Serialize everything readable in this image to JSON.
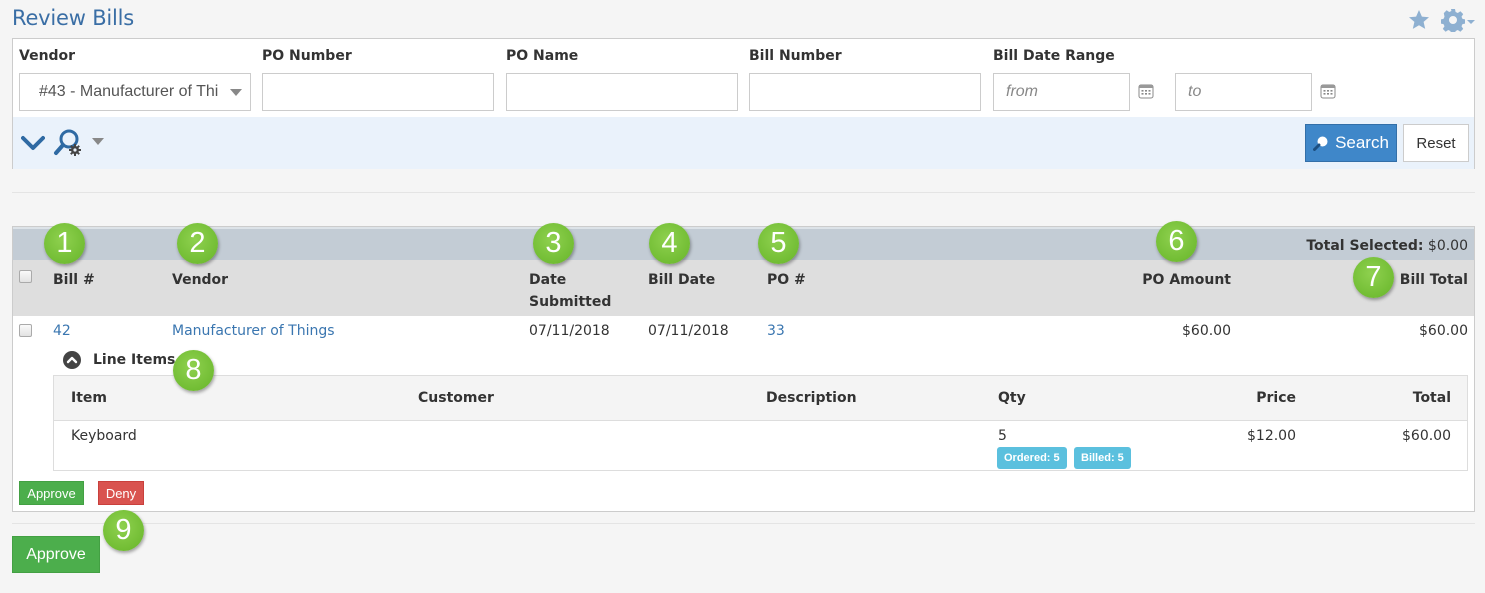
{
  "page": {
    "title": "Review Bills",
    "icons": [
      "star-icon",
      "gear-icon"
    ]
  },
  "filters": {
    "vendor": {
      "label": "Vendor",
      "value": "#43 - Manufacturer of Things",
      "display": "#43 - Manufacturer of Thi"
    },
    "po_number": {
      "label": "PO Number",
      "value": "",
      "placeholder": ""
    },
    "po_name": {
      "label": "PO Name",
      "value": "",
      "placeholder": ""
    },
    "bill_number": {
      "label": "Bill Number",
      "value": "",
      "placeholder": ""
    },
    "bill_date_range": {
      "label": "Bill Date Range",
      "from_placeholder": "from",
      "to_placeholder": "to"
    },
    "search_label": "Search",
    "reset_label": "Reset"
  },
  "results": {
    "total_selected_label": "Total Selected:",
    "total_selected_value": "$0.00",
    "columns": {
      "bill_no": "Bill #",
      "vendor": "Vendor",
      "date_submitted_1": "Date",
      "date_submitted_2": "Submitted",
      "bill_date": "Bill Date",
      "po_no": "PO #",
      "po_amount": "PO Amount",
      "bill_total": "Bill Total"
    },
    "rows": [
      {
        "bill_no": "42",
        "vendor": "Manufacturer of Things",
        "date_submitted": "07/11/2018",
        "bill_date": "07/11/2018",
        "po_no": "33",
        "po_amount": "$60.00",
        "bill_total": "$60.00",
        "line_items_label": "Line Items",
        "line_items": {
          "columns": {
            "item": "Item",
            "customer": "Customer",
            "description": "Description",
            "qty": "Qty",
            "price": "Price",
            "total": "Total"
          },
          "rows": [
            {
              "item": "Keyboard",
              "customer": "",
              "description": "",
              "qty": "5",
              "ordered_badge": "Ordered: 5",
              "billed_badge": "Billed: 5",
              "price": "$12.00",
              "total": "$60.00"
            }
          ]
        },
        "approve_label": "Approve",
        "deny_label": "Deny"
      }
    ],
    "approve_all_label": "Approve"
  },
  "callouts": [
    "1",
    "2",
    "3",
    "4",
    "5",
    "6",
    "7",
    "8",
    "9"
  ],
  "colors": {
    "title": "#3a6ea5",
    "link": "#3a76b0",
    "search_button": "#3f87c9",
    "approve": "#4cae4c",
    "deny": "#d9534f",
    "badge": "#5bc0de",
    "callout": "#72bd34"
  }
}
